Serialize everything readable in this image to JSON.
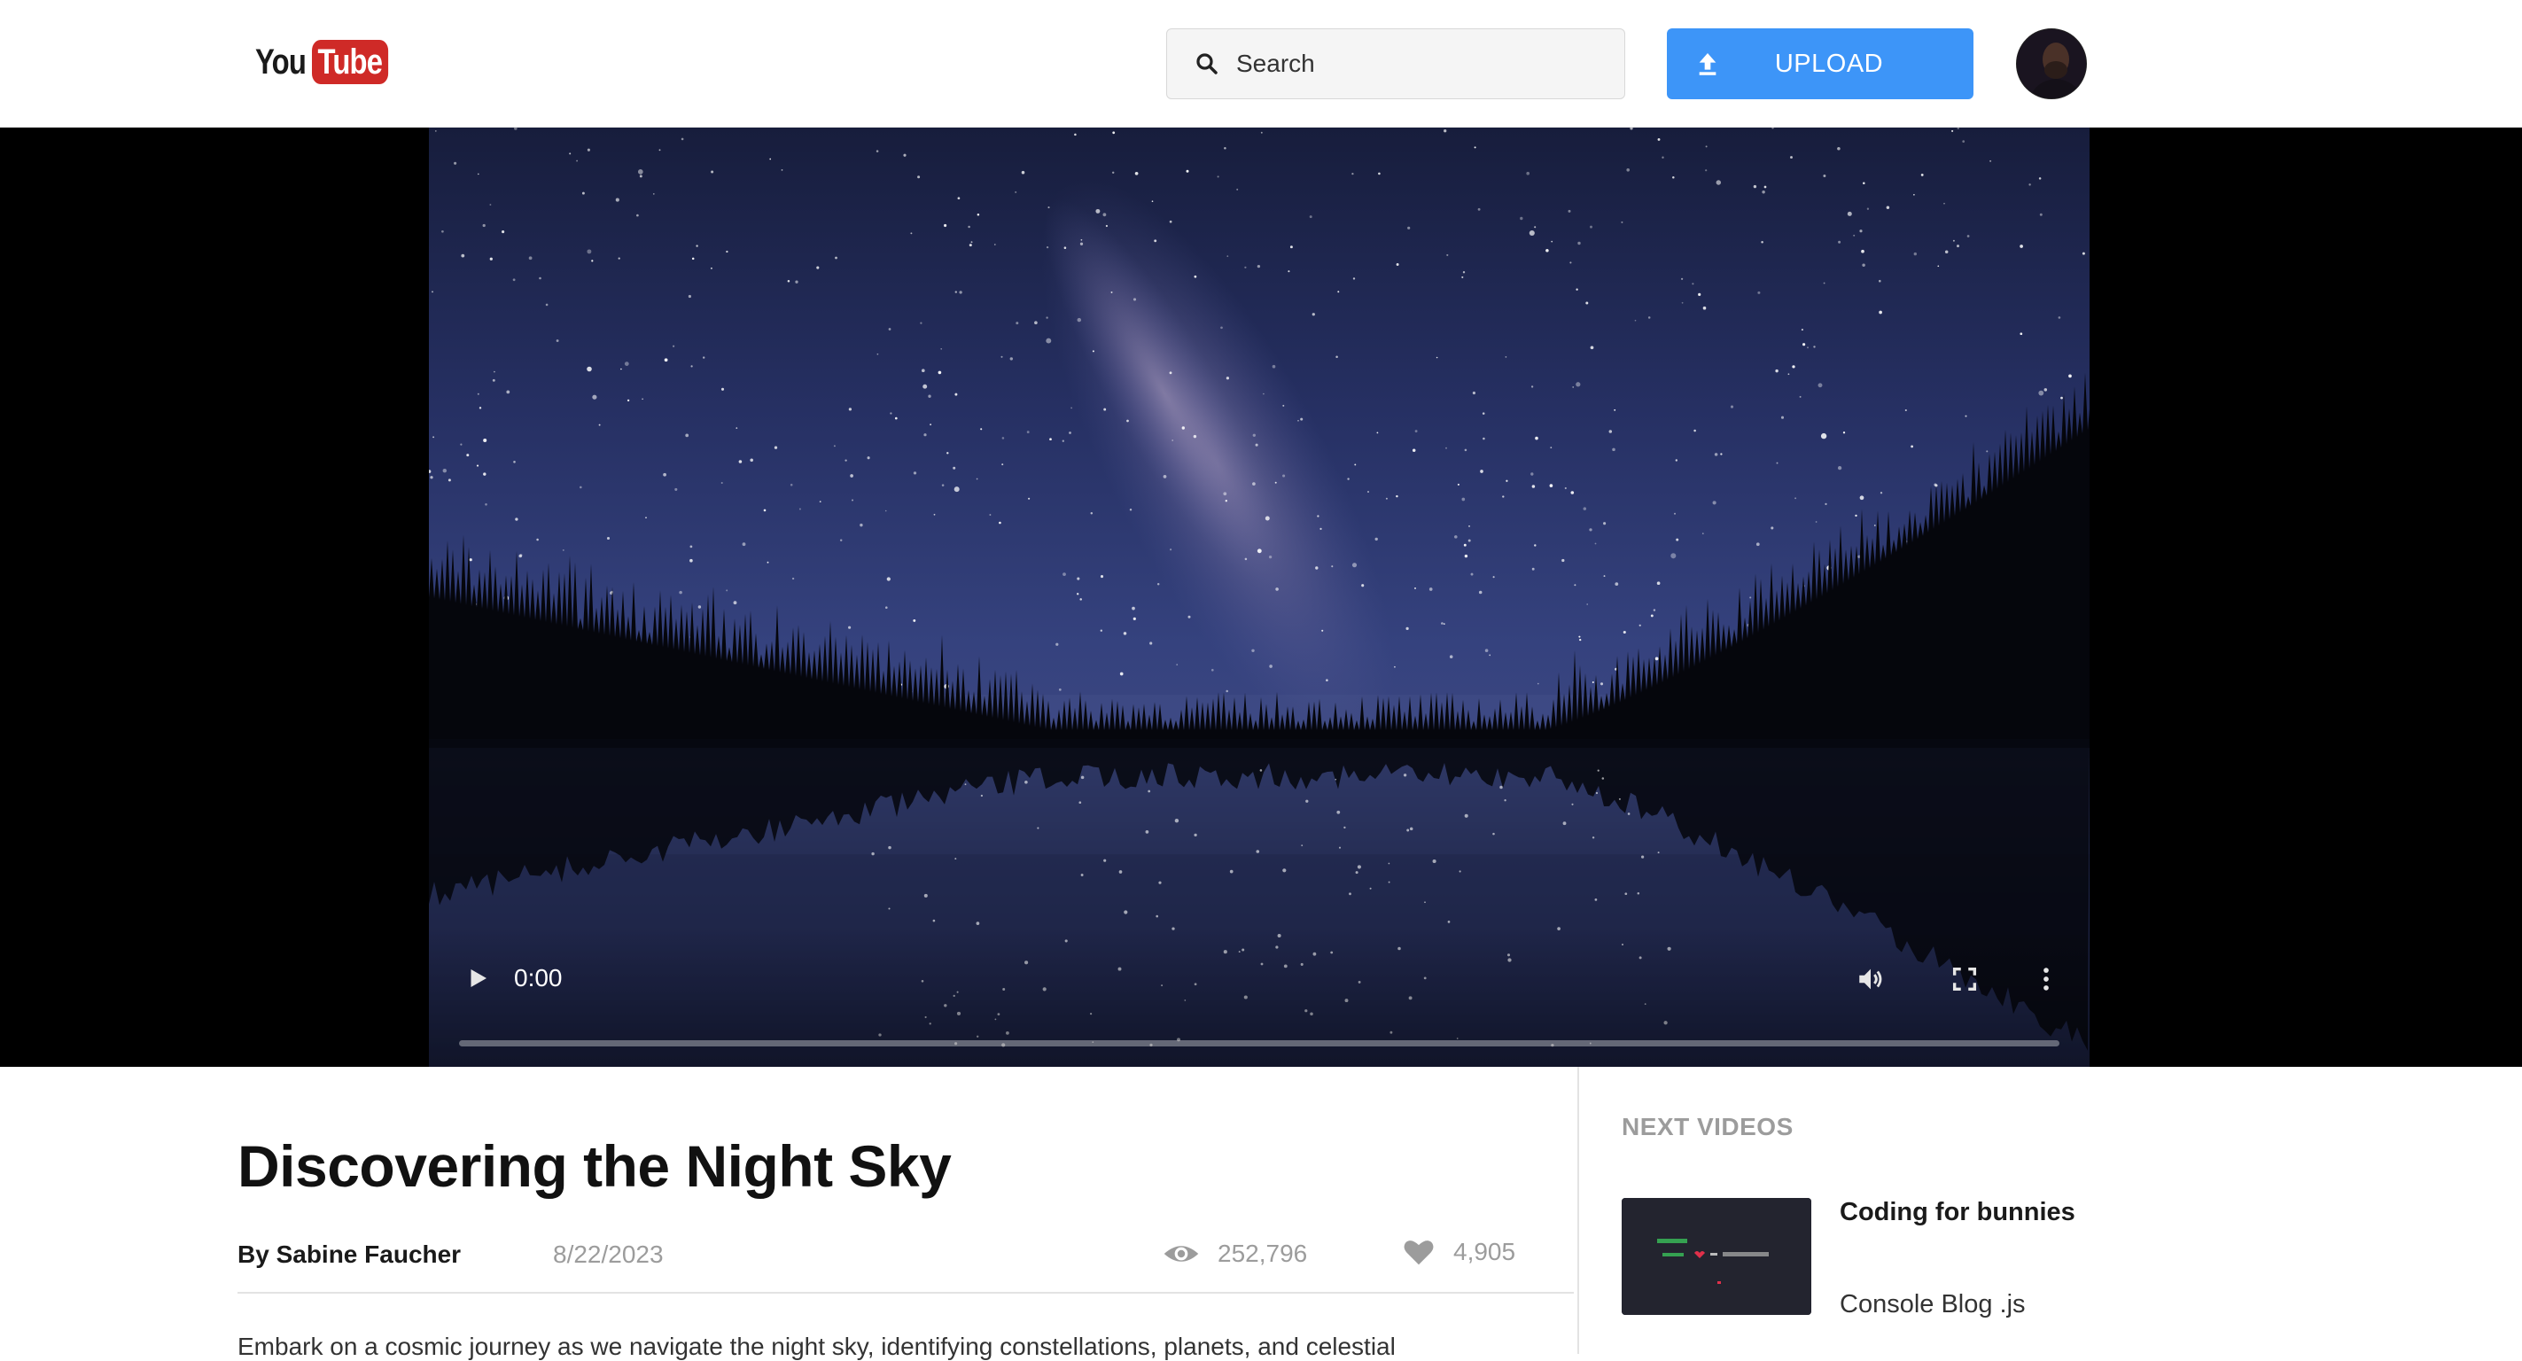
{
  "header": {
    "logo": {
      "part1": "You",
      "part2": "Tube"
    },
    "search": {
      "placeholder": "Search",
      "value": ""
    },
    "upload_label": "UPLOAD",
    "icons": {
      "search": "search-icon",
      "upload": "upload-icon",
      "avatar": "user-avatar"
    }
  },
  "player": {
    "current_time": "0:00",
    "progress": 0,
    "icons": [
      "play-icon",
      "volume-icon",
      "fullscreen-icon",
      "more-vertical-icon"
    ]
  },
  "video": {
    "title": "Discovering the Night Sky",
    "author": "By Sabine Faucher",
    "date": "8/22/2023",
    "views": "252,796",
    "likes": "4,905",
    "description": "Embark on a cosmic journey as we navigate the night sky, identifying constellations, planets, and celestial"
  },
  "sidebar": {
    "heading": "NEXT VIDEOS",
    "items": [
      {
        "title": "Coding for bunnies",
        "channel": "Console Blog .js"
      }
    ]
  },
  "colors": {
    "accent": "#3d95f8",
    "logo_red": "#cf2a27",
    "muted_text": "#9c9c9c"
  }
}
